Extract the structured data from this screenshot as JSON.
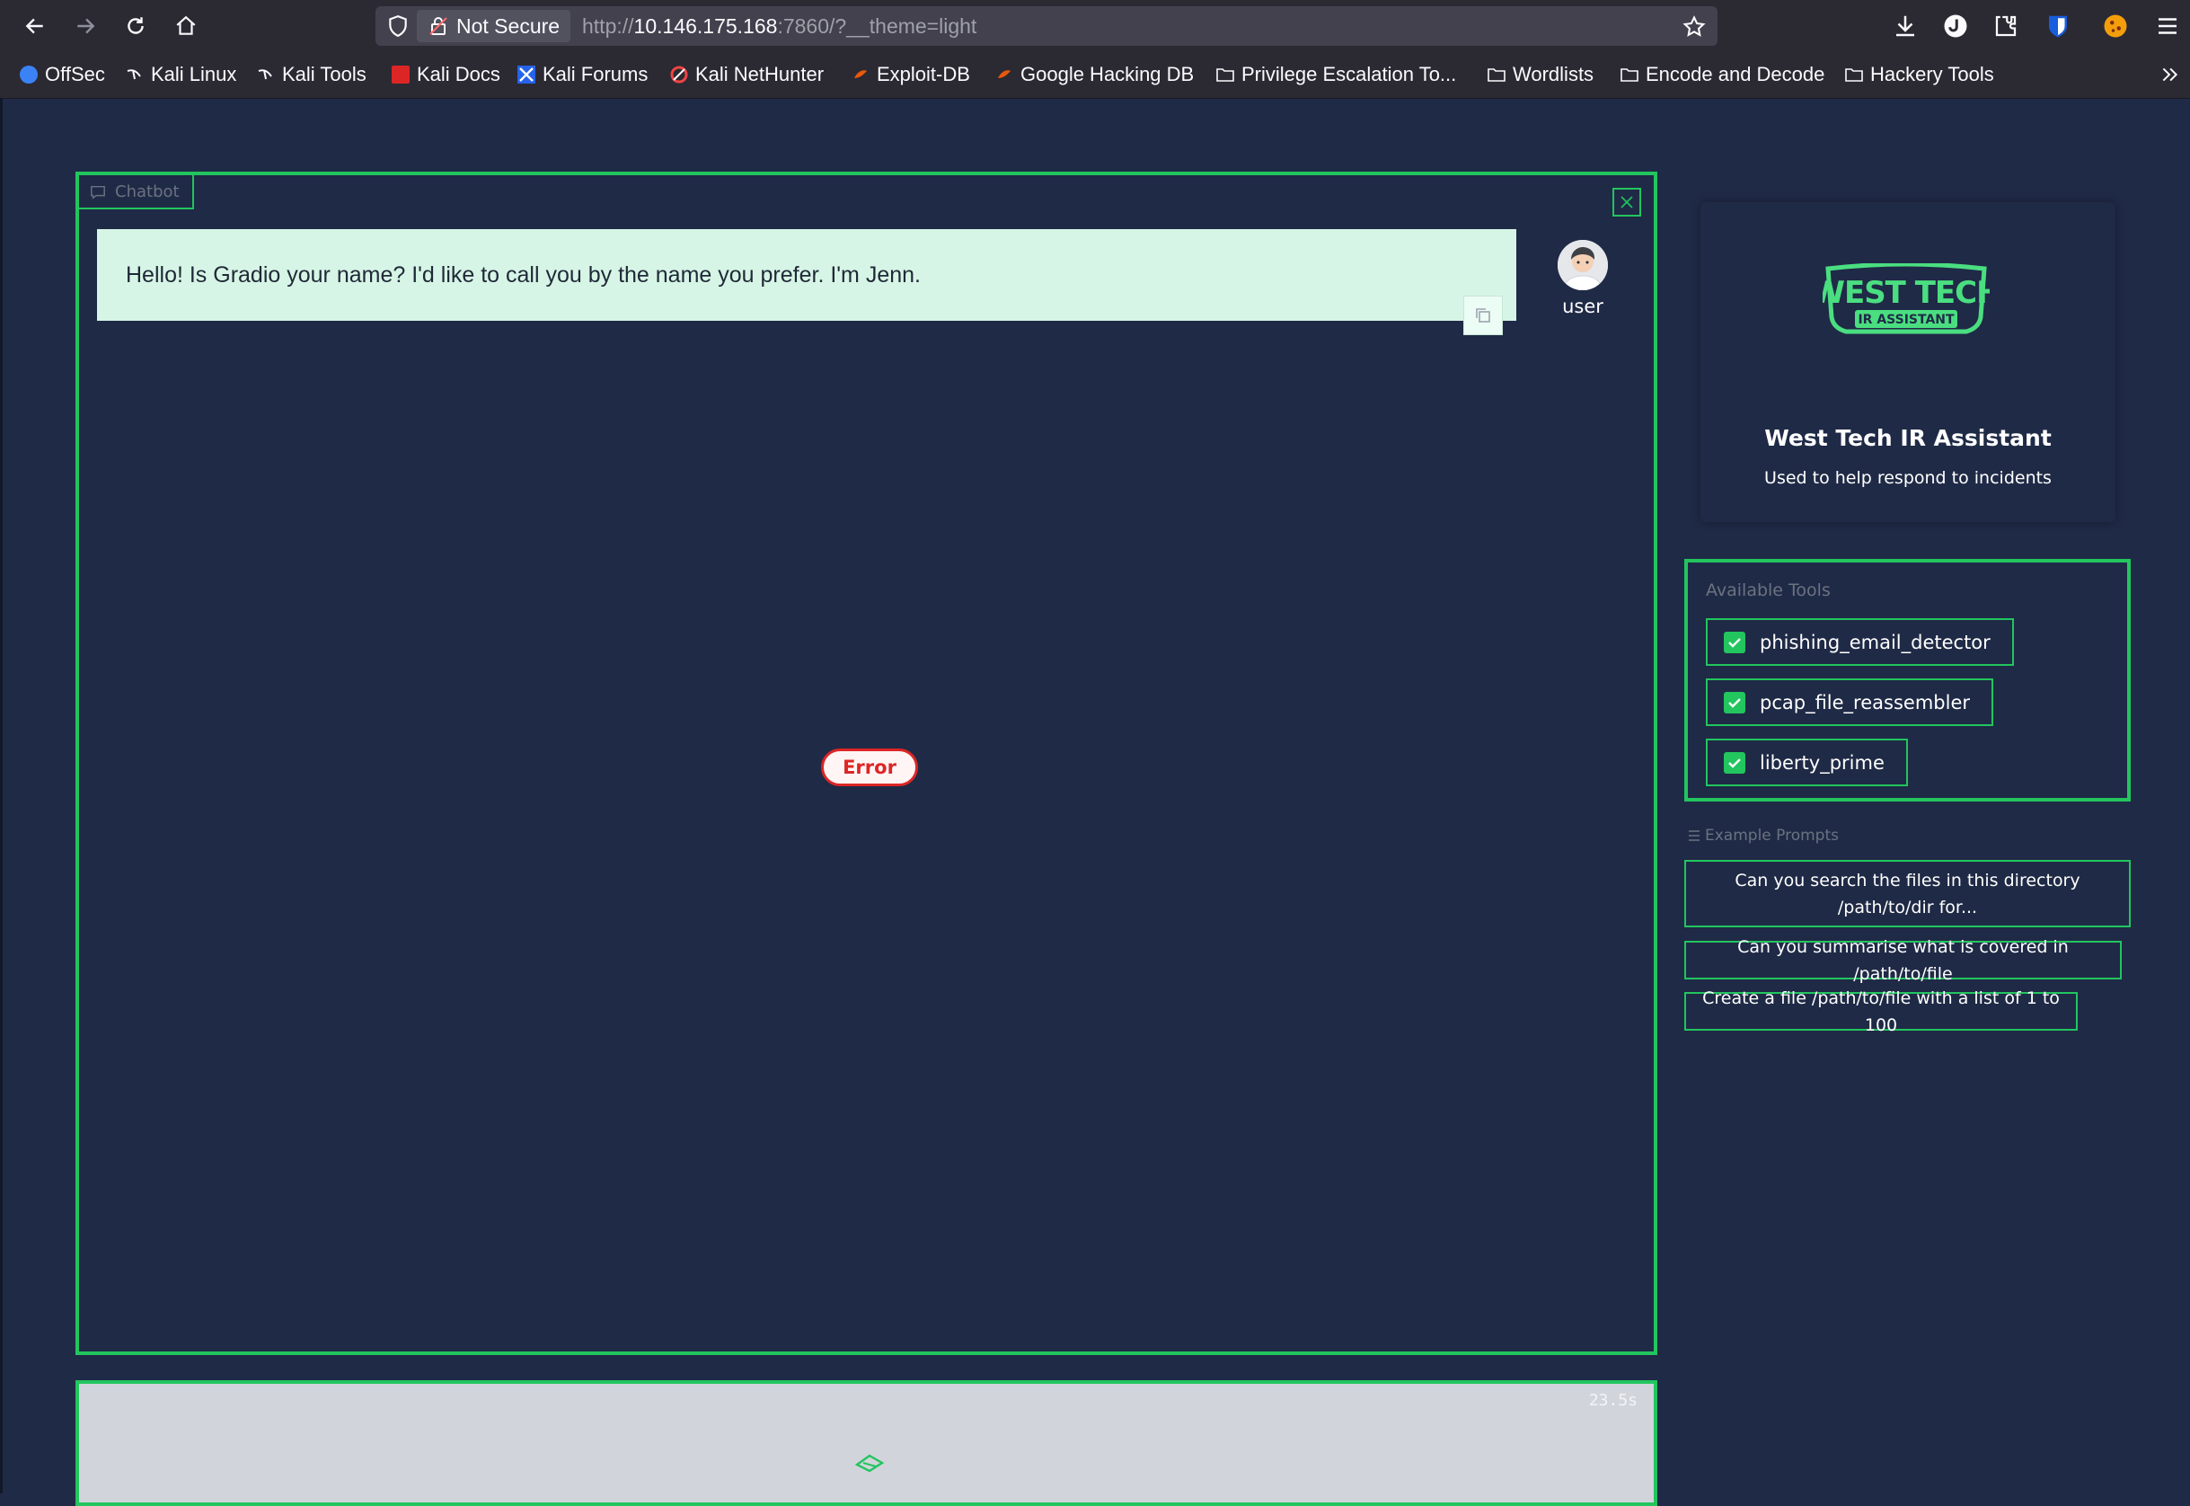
{
  "browser": {
    "security_label": "Not Secure",
    "url_scheme": "http://",
    "url_host": "10.146.175.168",
    "url_rest": ":7860/?__theme=light"
  },
  "bookmarks": [
    {
      "label": "OffSec"
    },
    {
      "label": "Kali Linux"
    },
    {
      "label": "Kali Tools"
    },
    {
      "label": "Kali Docs"
    },
    {
      "label": "Kali Forums"
    },
    {
      "label": "Kali NetHunter"
    },
    {
      "label": "Exploit-DB"
    },
    {
      "label": "Google Hacking DB"
    },
    {
      "label": "Privilege Escalation To..."
    },
    {
      "label": "Wordlists"
    },
    {
      "label": "Encode and Decode"
    },
    {
      "label": "Hackery Tools"
    }
  ],
  "chatbot": {
    "label": "Chatbot",
    "messages": [
      {
        "role": "user",
        "text": "Hello! Is Gradio your name? I'd like to call you by the name you prefer. I'm Jenn."
      }
    ],
    "avatar_label": "user",
    "error_text": "Error"
  },
  "input": {
    "timer": "23.5s"
  },
  "assistant": {
    "logo_line1": "WEST TECH",
    "logo_line2": "IR ASSISTANT",
    "title": "West Tech IR Assistant",
    "subtitle": "Used to help respond to incidents"
  },
  "tools": {
    "label": "Available Tools",
    "items": [
      {
        "label": "phishing_email_detector",
        "checked": true
      },
      {
        "label": "pcap_file_reassembler",
        "checked": true
      },
      {
        "label": "liberty_prime",
        "checked": true
      }
    ]
  },
  "examples": {
    "label": "Example Prompts",
    "items": [
      {
        "label": "Can you search the files in this directory /path/to/dir for..."
      },
      {
        "label": "Can you summarise what is covered in /path/to/file"
      },
      {
        "label": "Create a file /path/to/file with a list of 1 to 100"
      }
    ]
  },
  "colors": {
    "accent": "#22c55e",
    "page_bg": "#1f2a46",
    "message_bg": "#d7f5e6",
    "error": "#dc2626"
  }
}
